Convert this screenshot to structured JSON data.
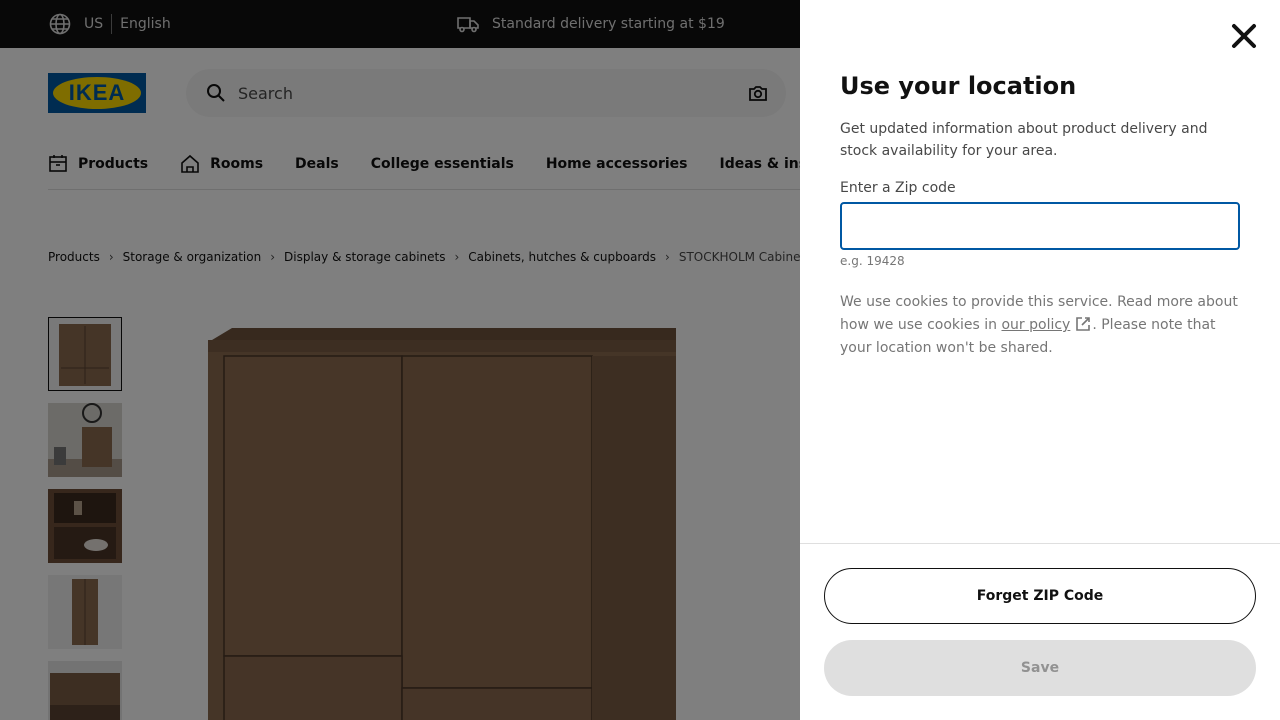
{
  "topbar": {
    "country": "US",
    "language": "English",
    "delivery_text": "Standard delivery starting at $19"
  },
  "header": {
    "logo_text": "IKEA",
    "search_placeholder": "Search"
  },
  "nav": {
    "items": [
      {
        "label": "Products",
        "icon": "cabinet-icon"
      },
      {
        "label": "Rooms",
        "icon": "house-icon"
      },
      {
        "label": "Deals"
      },
      {
        "label": "College essentials"
      },
      {
        "label": "Home accessories"
      },
      {
        "label": "Ideas & inspira"
      }
    ]
  },
  "breadcrumb": {
    "items": [
      "Products",
      "Storage & organization",
      "Display & storage cabinets",
      "Cabinets, hutches & cupboards"
    ],
    "current": "STOCKHOLM Cabinet with"
  },
  "modal": {
    "title": "Use your location",
    "description": "Get updated information about product delivery and stock availability for your area.",
    "input_label": "Enter a Zip code",
    "input_value": "",
    "hint": "e.g. 19428",
    "cookie_text_1": "We use cookies to provide this service. Read more about how we use cookies in",
    "cookie_link": "our policy",
    "cookie_text_2": ". Please note that your location won't be shared.",
    "forget_label": "Forget ZIP Code",
    "save_label": "Save"
  },
  "colors": {
    "brand_blue": "#0058a3",
    "brand_yellow": "#ffdb00",
    "wood": "#8b6a4f"
  }
}
